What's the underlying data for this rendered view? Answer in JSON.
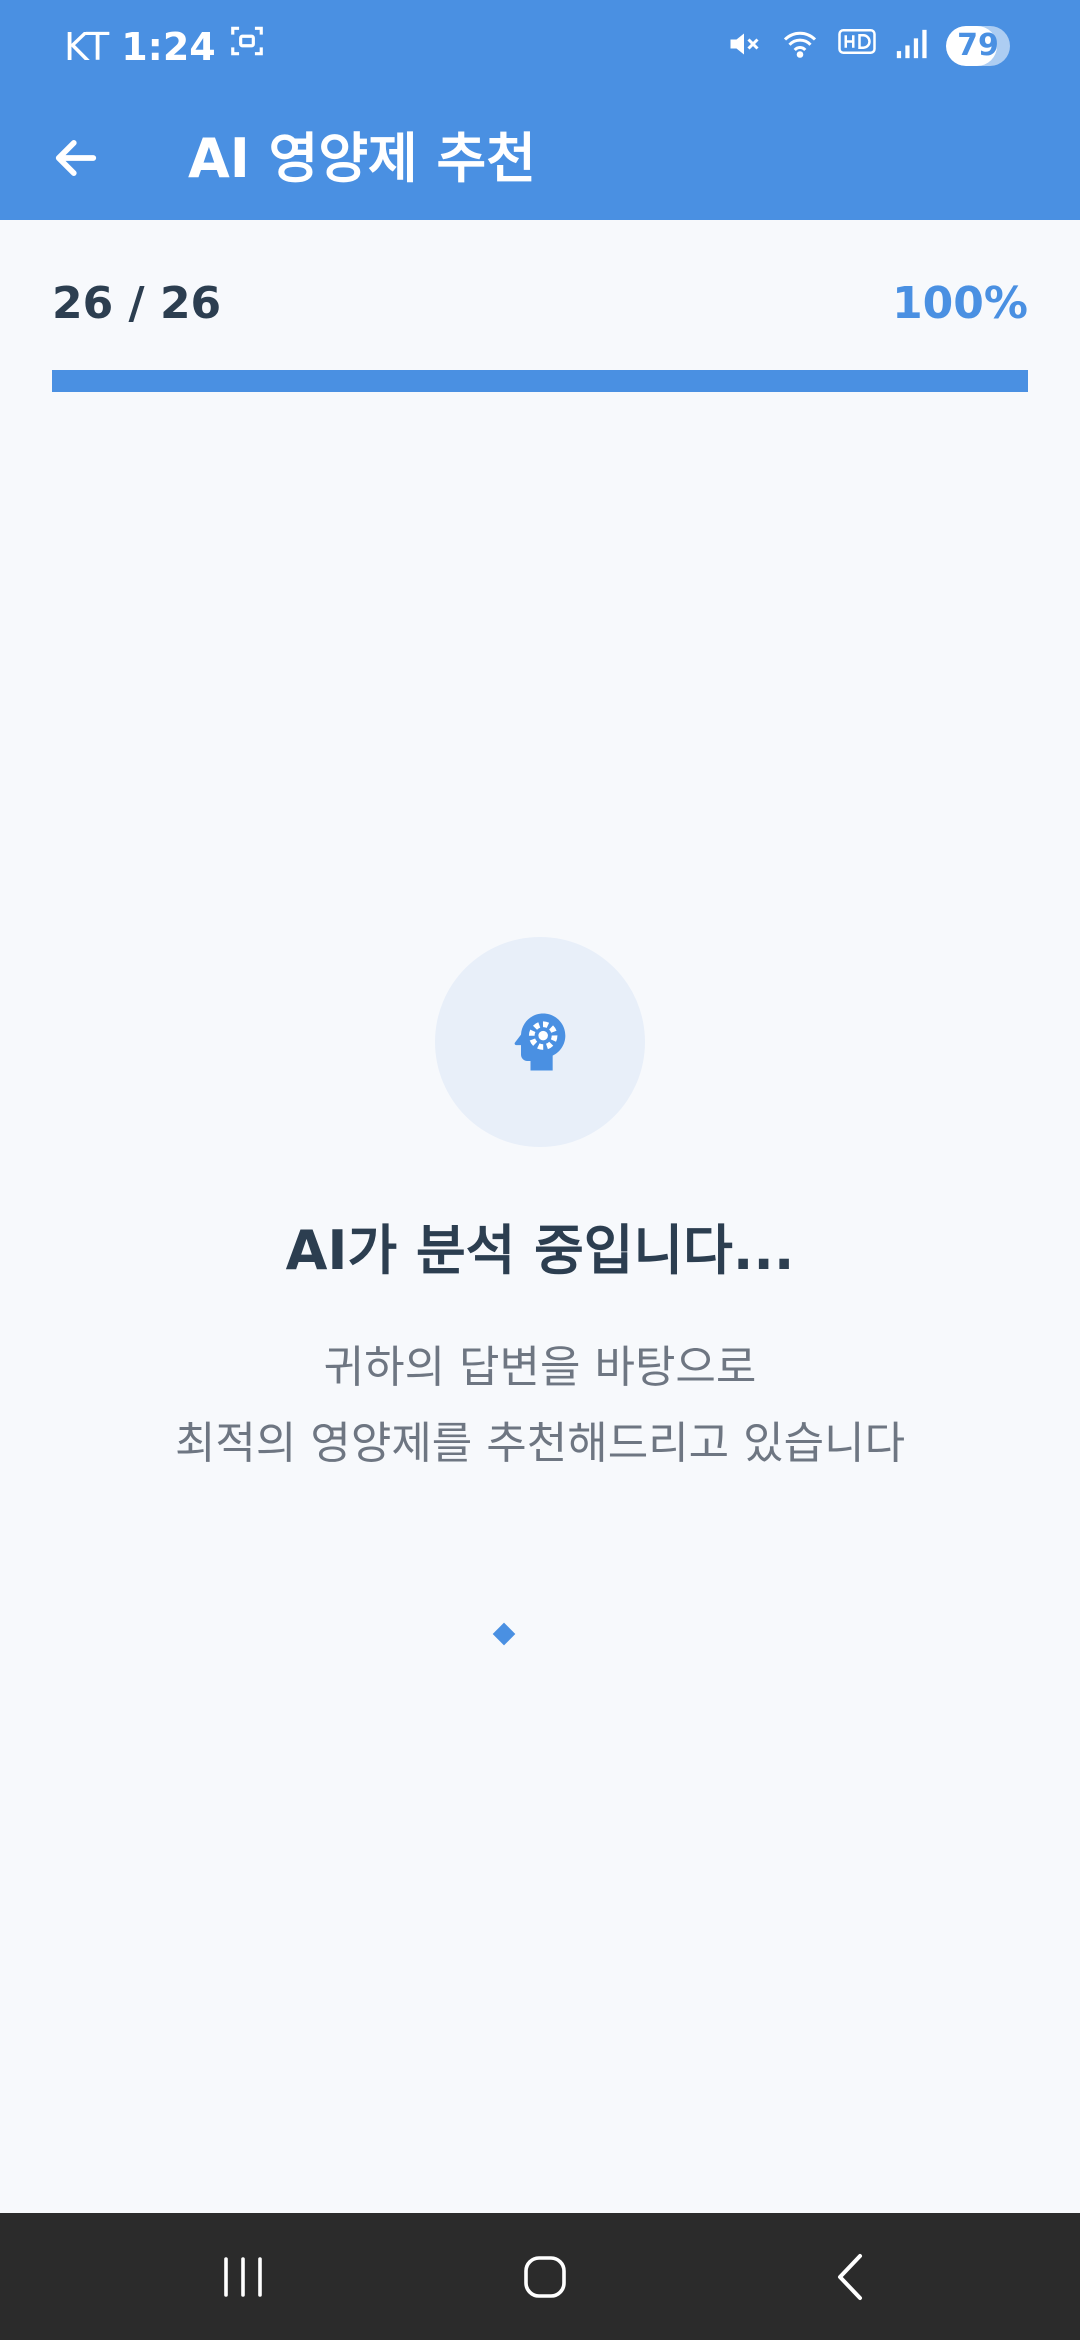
{
  "status_bar": {
    "carrier": "KT",
    "time": "1:24",
    "battery_level": "79",
    "battery_fraction": 0.79,
    "icons": [
      "screenshot-icon",
      "mute-icon",
      "wifi-icon",
      "hd-icon",
      "signal-icon",
      "battery-icon"
    ]
  },
  "app_bar": {
    "title": "AI 영양제 추천",
    "back_icon": "arrow-left-icon"
  },
  "progress": {
    "count_text": "26 / 26",
    "percent_text": "100%",
    "fraction": 1.0
  },
  "analysis": {
    "icon": "head-gear-icon",
    "title": "AI가 분석 중입니다...",
    "description_line1": "귀하의 답변을 바탕으로",
    "description_line2": "최적의 영양제를 추천해드리고 있습니다"
  },
  "nav_bar": {
    "icons": [
      "recent-apps-icon",
      "home-icon",
      "back-icon"
    ]
  },
  "colors": {
    "primary": "#4A90E2",
    "background": "#F7F9FC",
    "title_text": "#2C3E50",
    "secondary_text": "#6E7682",
    "nav_background": "#2B2B2B"
  }
}
